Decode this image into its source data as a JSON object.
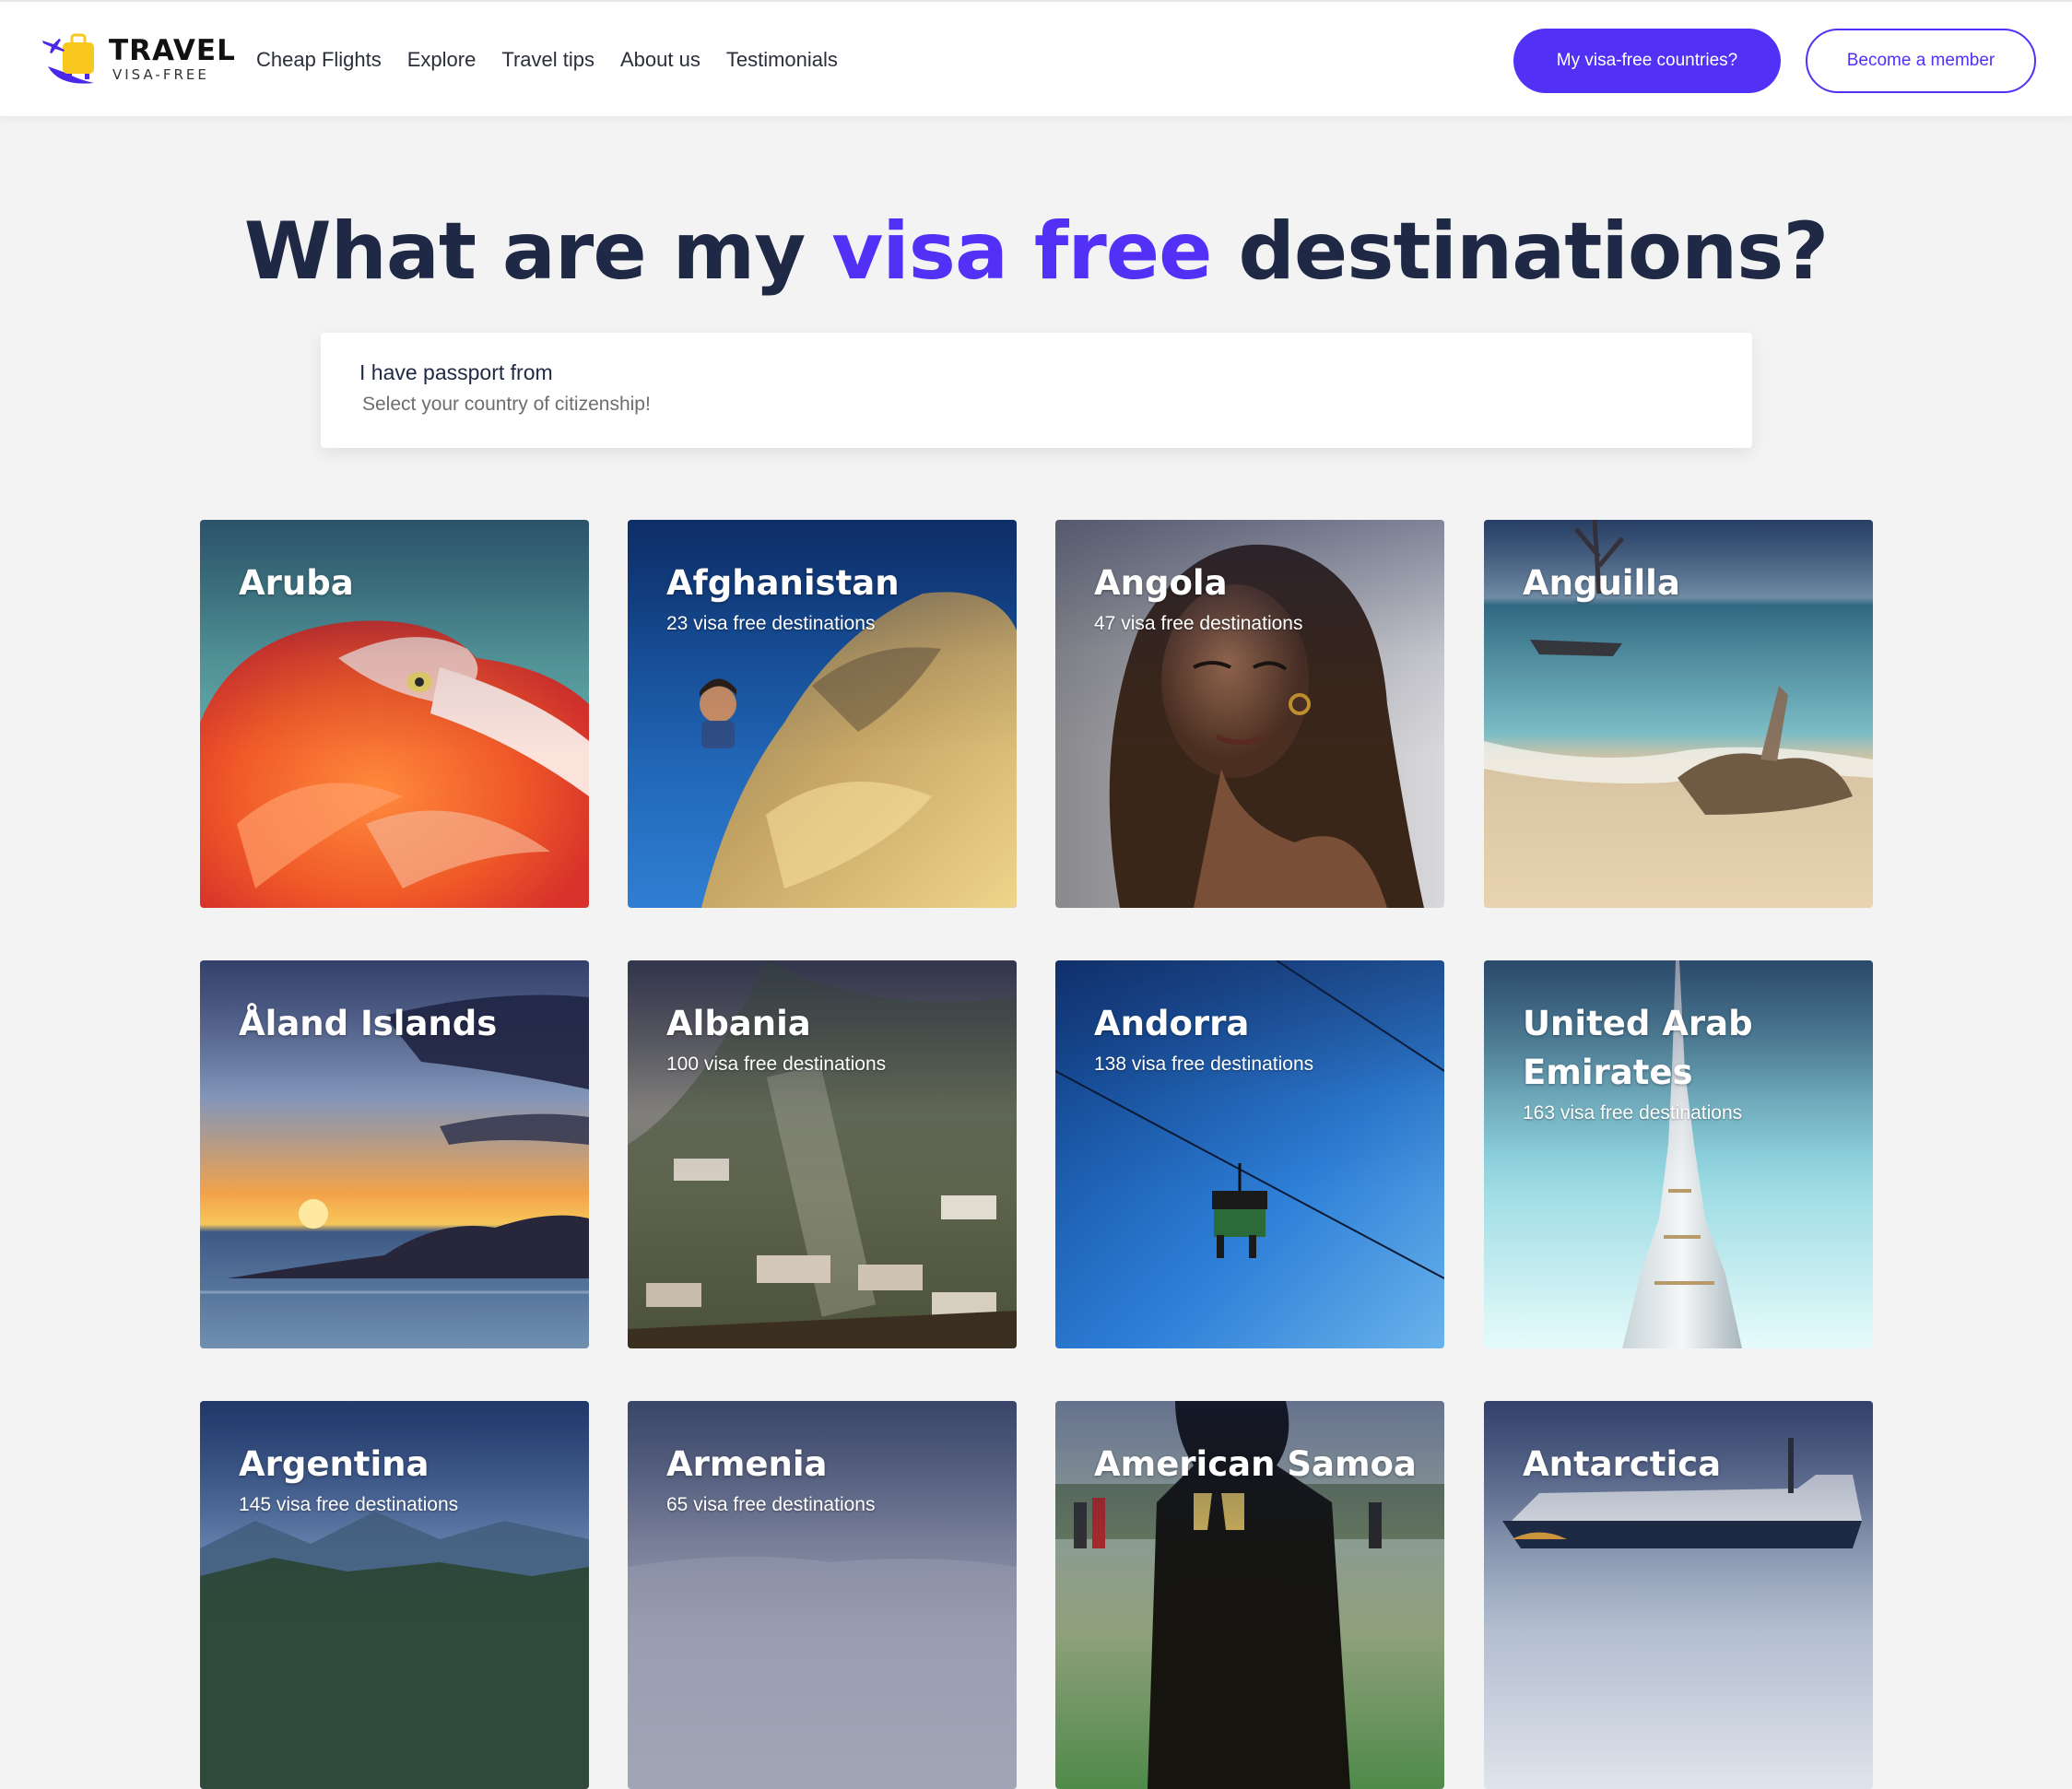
{
  "brand": {
    "name": "TRAVEL",
    "tagline": "VISA-FREE"
  },
  "nav": [
    {
      "label": "Cheap Flights"
    },
    {
      "label": "Explore"
    },
    {
      "label": "Travel tips"
    },
    {
      "label": "About us"
    },
    {
      "label": "Testimonials"
    }
  ],
  "header_actions": {
    "primary_label": "My visa-free countries?",
    "secondary_label": "Become a member"
  },
  "hero": {
    "title_before": "What are my ",
    "title_accent": "visa free",
    "title_after": " destinations?"
  },
  "search": {
    "label": "I have passport from",
    "placeholder": "Select your country of citizenship!"
  },
  "colors": {
    "accent": "#5230f5",
    "heading": "#1f2946",
    "background": "#f3f3f3"
  },
  "countries": [
    {
      "name": "Aruba",
      "subtitle": "",
      "image": "flamingo"
    },
    {
      "name": "Afghanistan",
      "subtitle": "23 visa free destinations",
      "image": "rock-boy"
    },
    {
      "name": "Angola",
      "subtitle": "47 visa free destinations",
      "image": "portrait"
    },
    {
      "name": "Anguilla",
      "subtitle": "",
      "image": "beach-driftwood"
    },
    {
      "name": "Åland Islands",
      "subtitle": "",
      "image": "sunset-sea"
    },
    {
      "name": "Albania",
      "subtitle": "100 visa free destinations",
      "image": "hillside-town"
    },
    {
      "name": "Andorra",
      "subtitle": "138 visa free destinations",
      "image": "chairlift"
    },
    {
      "name": "United Arab Emirates",
      "subtitle": "163 visa free destinations",
      "image": "skyscraper"
    },
    {
      "name": "Argentina",
      "subtitle": "145 visa free destinations",
      "image": "mountains"
    },
    {
      "name": "Armenia",
      "subtitle": "65 visa free destinations",
      "image": "fog"
    },
    {
      "name": "American Samoa",
      "subtitle": "",
      "image": "football-player"
    },
    {
      "name": "Antarctica",
      "subtitle": "",
      "image": "ship"
    }
  ]
}
